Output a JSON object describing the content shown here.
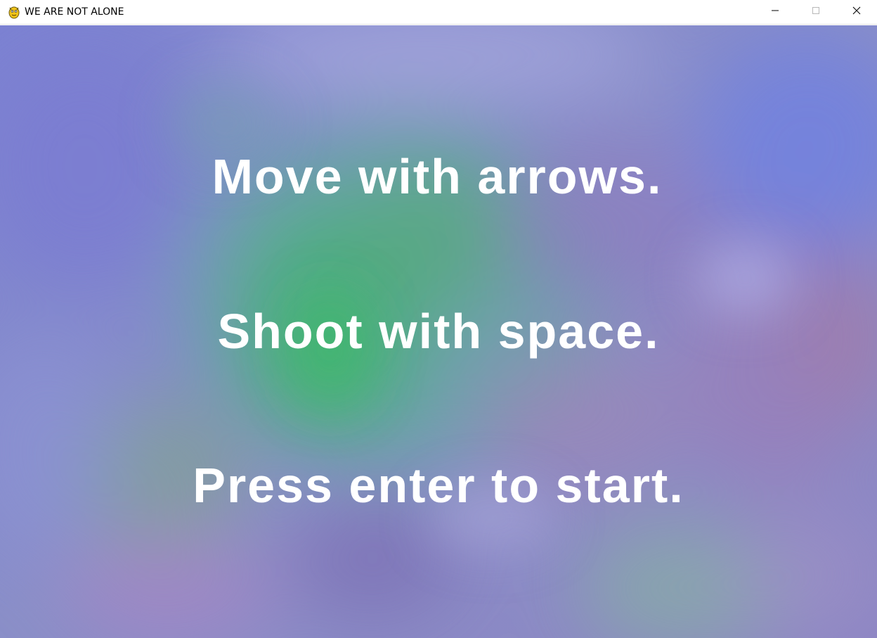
{
  "window": {
    "title": "WE ARE NOT ALONE",
    "app_icon": "pygame-snake-icon",
    "controls": [
      "minimize-icon",
      "maximize-icon",
      "close-icon"
    ]
  },
  "game": {
    "background": "blurred nebula",
    "instructions": [
      "Move with arrows.",
      "Shoot with space.",
      "Press enter to start."
    ],
    "text_color": "#ffffff"
  }
}
